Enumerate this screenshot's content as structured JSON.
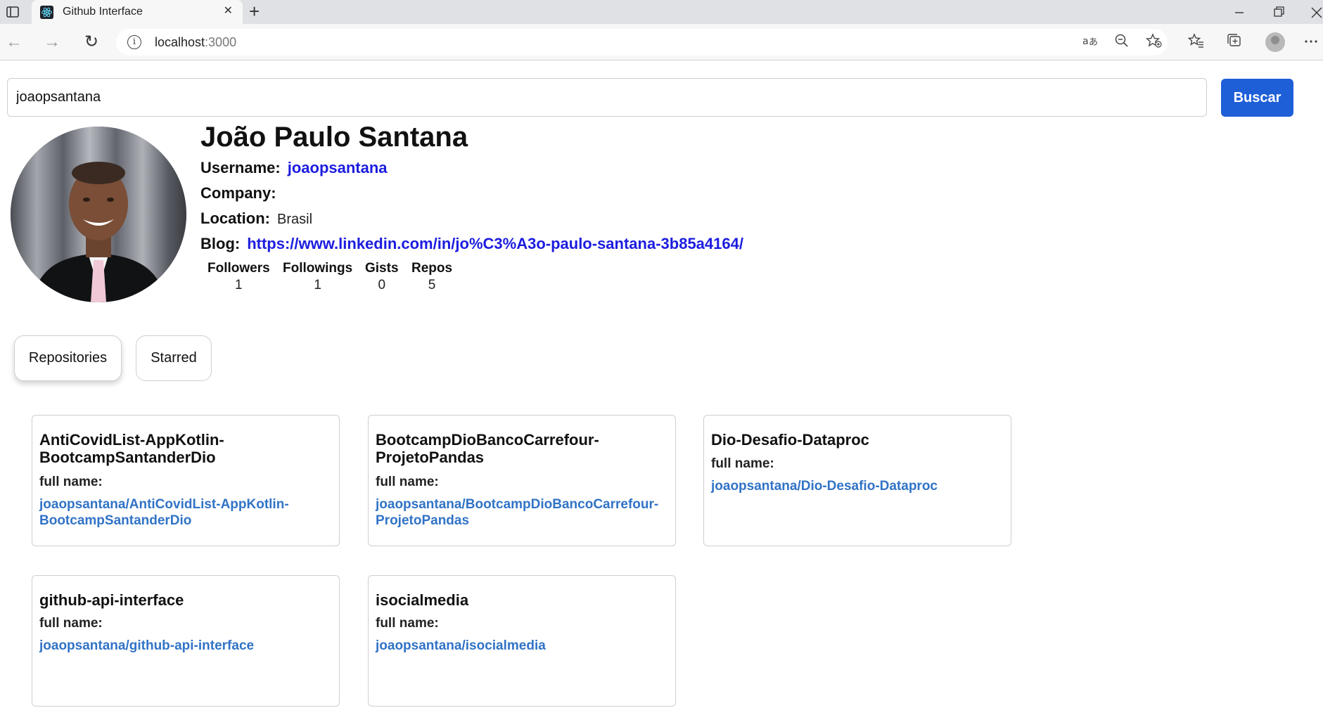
{
  "browser": {
    "tab_title": "Github Interface",
    "tab_close": "✕",
    "new_tab": "+",
    "url_host": "localhost",
    "url_port": ":3000",
    "icons": [
      "window-menu-icon",
      "react-favicon-icon",
      "back-icon",
      "forward-icon",
      "reload-icon",
      "info-icon",
      "read-aloud-icon",
      "zoom-out-icon",
      "add-favorite-icon",
      "favorites-icon",
      "collections-icon",
      "profile-icon",
      "more-icon",
      "minimize-icon",
      "restore-icon",
      "close-window-icon"
    ]
  },
  "search": {
    "value": "joaopsantana",
    "button_label": "Buscar",
    "button_color": "#1e5fd8"
  },
  "profile": {
    "name": "João Paulo Santana",
    "username_label": "Username:",
    "username": "joaopsantana",
    "company_label": "Company:",
    "company": "",
    "location_label": "Location:",
    "location": "Brasil",
    "blog_label": "Blog:",
    "blog": "https://www.linkedin.com/in/jo%C3%A3o-paulo-santana-3b85a4164/",
    "link_color": "#1c1ce0",
    "stats": [
      {
        "label": "Followers",
        "value": "1"
      },
      {
        "label": "Followings",
        "value": "1"
      },
      {
        "label": "Gists",
        "value": "0"
      },
      {
        "label": "Repos",
        "value": "5"
      }
    ]
  },
  "tabs": [
    {
      "label": "Repositories",
      "selected": true
    },
    {
      "label": "Starred",
      "selected": false
    }
  ],
  "repos": {
    "full_name_label": "full name:",
    "items": [
      {
        "name": "AntiCovidList-AppKotlin-BootcampSantanderDio",
        "full_name": "joaopsantana/AntiCovidList-AppKotlin-BootcampSantanderDio"
      },
      {
        "name": "BootcampDioBancoCarrefour-ProjetoPandas",
        "full_name": "joaopsantana/BootcampDioBancoCarrefour-ProjetoPandas"
      },
      {
        "name": "Dio-Desafio-Dataproc",
        "full_name": "joaopsantana/Dio-Desafio-Dataproc"
      },
      {
        "name": "github-api-interface",
        "full_name": "joaopsantana/github-api-interface"
      },
      {
        "name": "isocialmedia",
        "full_name": "joaopsantana/isocialmedia"
      }
    ],
    "link_color": "#3173c6"
  }
}
